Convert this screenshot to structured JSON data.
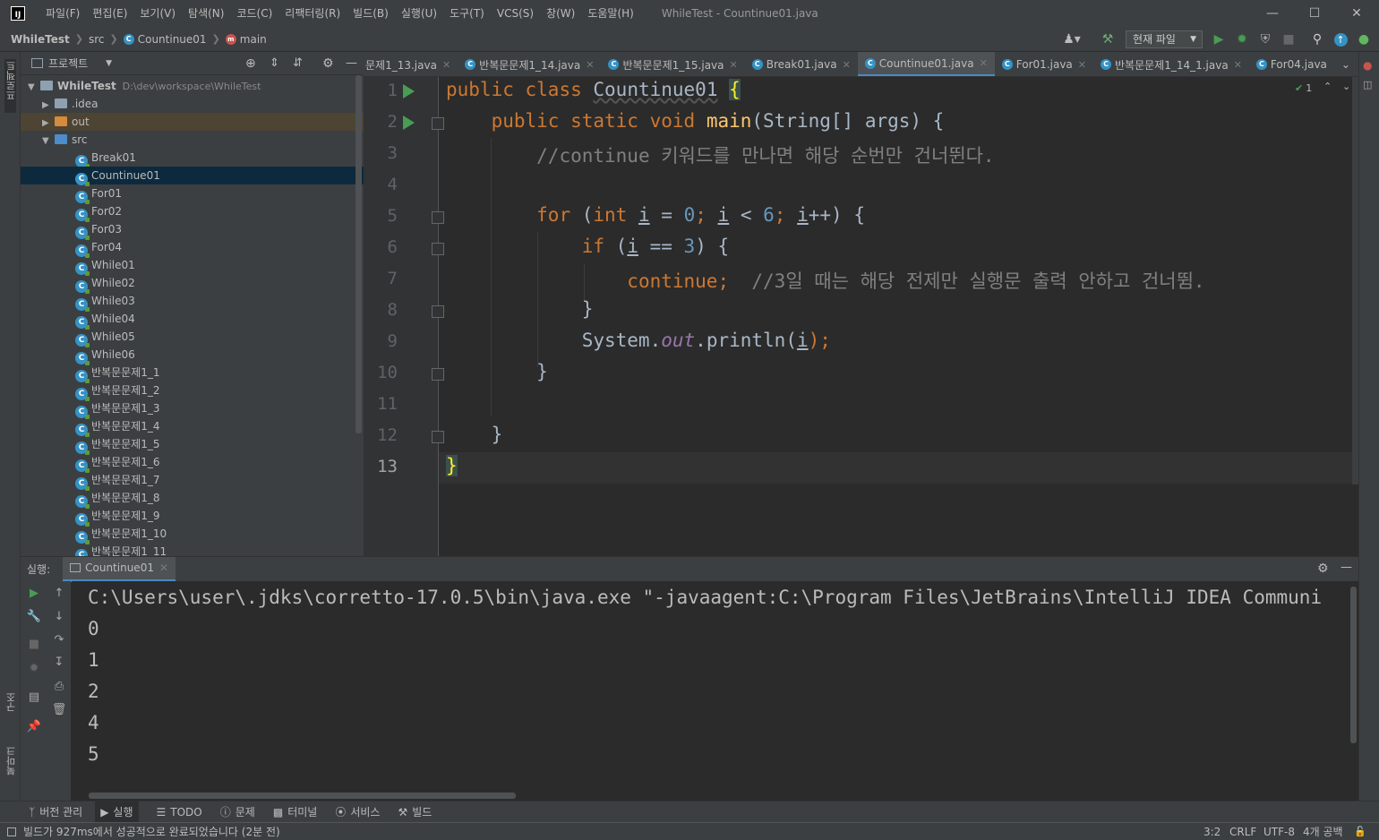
{
  "menu": [
    "파일(F)",
    "편집(E)",
    "보기(V)",
    "탐색(N)",
    "코드(C)",
    "리팩터링(R)",
    "빌드(B)",
    "실행(U)",
    "도구(T)",
    "VCS(S)",
    "창(W)",
    "도움말(H)"
  ],
  "window_title": "WhileTest - Countinue01.java",
  "breadcrumb": {
    "project": "WhileTest",
    "folder": "src",
    "class": "Countinue01",
    "method": "main"
  },
  "run_config": "현재 파일",
  "left_strip_labels": {
    "project": "프로젝트",
    "structure": "구조",
    "bookmarks": "북마크"
  },
  "project_panel": {
    "title": "프로젝트",
    "root": {
      "name": "WhileTest",
      "path": "D:\\dev\\workspace\\WhileTest"
    },
    "folders": [
      ".idea",
      "out",
      "src"
    ],
    "files": [
      "Break01",
      "Countinue01",
      "For01",
      "For02",
      "For03",
      "For04",
      "While01",
      "While02",
      "While03",
      "While04",
      "While05",
      "While06",
      "반복문문제1_1",
      "반복문문제1_2",
      "반복문문제1_3",
      "반복문문제1_4",
      "반복문문제1_5",
      "반복문문제1_6",
      "반복문문제1_7",
      "반복문문제1_8",
      "반복문문제1_9",
      "반복문문제1_10",
      "반복문문제1_11"
    ],
    "selected": "Countinue01"
  },
  "editor_tabs": [
    "문제1_13.java",
    "반복문문제1_14.java",
    "반복문문제1_15.java",
    "Break01.java",
    "Countinue01.java",
    "For01.java",
    "반복문문제1_14_1.java",
    "For04.java"
  ],
  "active_tab": "Countinue01.java",
  "inspection_count": "1",
  "line_numbers": [
    "1",
    "2",
    "3",
    "4",
    "5",
    "6",
    "7",
    "8",
    "9",
    "10",
    "11",
    "12",
    "13"
  ],
  "code": {
    "l1_public": "public",
    "l1_class": "class",
    "l1_name": "Countinue01",
    "l1_brace": "{",
    "l2_mods": "public static void",
    "l2_main": "main",
    "l2_rest": "(String[] args) {",
    "l3": "//continue 키워드를 만나면 해당 순번만 건너뛴다.",
    "l5_for": "for",
    "l5_a": " (",
    "l5_int": "int",
    "l5_i1": "i",
    "l5_eq": " = ",
    "l5_0": "0",
    "l5_semi1": ";",
    "l5_i2": "i",
    "l5_lt": " < ",
    "l5_6": "6",
    "l5_semi2": ";",
    "l5_i3": "i",
    "l5_end": "++) {",
    "l6_if": "if",
    "l6_a": " (",
    "l6_i": "i",
    "l6_eq": " == ",
    "l6_3": "3",
    "l6_end": ") {",
    "l7_cont": "continue;",
    "l7_cm": "//3일 때는 해당 전제만 실행문 출력 안하고 건너뜀.",
    "l8": "}",
    "l9_sys": "System.",
    "l9_out": "out",
    "l9_print": ".println(",
    "l9_i": "i",
    "l9_end": ");",
    "l10": "}",
    "l12": "}",
    "l13": "}"
  },
  "run_panel": {
    "label": "실행:",
    "tab": "Countinue01",
    "command": "C:\\Users\\user\\.jdks\\corretto-17.0.5\\bin\\java.exe \"-javaagent:C:\\Program Files\\JetBrains\\IntelliJ IDEA Communi",
    "output": [
      "0",
      "1",
      "2",
      "4",
      "5"
    ]
  },
  "bottom_tools": [
    "버전 관리",
    "실행",
    "TODO",
    "문제",
    "터미널",
    "서비스",
    "빌드"
  ],
  "active_bottom_tool": "실행",
  "status": {
    "message": "빌드가 927ms에서 성공적으로 완료되었습니다 (2분 전)",
    "position": "3:2",
    "line_sep": "CRLF",
    "encoding": "UTF-8",
    "indent": "4개 공백"
  },
  "colors": {
    "keyword": "#cc7832",
    "function": "#ffc66d",
    "number": "#6897bb",
    "comment": "#808080",
    "field": "#9876aa",
    "run": "#499c54",
    "selection": "#0d293e",
    "accent": "#4a88c7"
  },
  "icons": [
    "intellij-logo-icon",
    "minimize-icon",
    "maximize-icon",
    "close-icon",
    "project-icon",
    "run-icon",
    "debug-icon",
    "coverage-icon",
    "stop-icon",
    "search-icon",
    "update-icon",
    "build-hammer-icon",
    "user-icon",
    "gear-icon",
    "folder-icon",
    "java-class-icon",
    "rerun-icon",
    "wrench-icon",
    "pin-icon",
    "print-icon",
    "trash-icon"
  ]
}
